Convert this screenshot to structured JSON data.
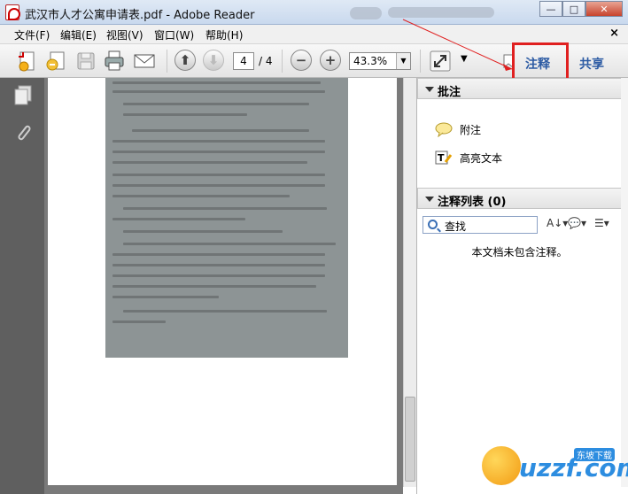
{
  "window": {
    "title": "武汉市人才公寓申请表.pdf - Adobe Reader",
    "controls": {
      "minimize": "—",
      "maximize": "□",
      "close": "✕"
    }
  },
  "menubar": {
    "items": [
      "文件(F)",
      "编辑(E)",
      "视图(V)",
      "窗口(W)",
      "帮助(H)"
    ],
    "close_doc": "×"
  },
  "toolbar": {
    "page_current": "4",
    "page_total": "/ 4",
    "zoom": "43.3%",
    "comment_label": "注释",
    "share_label": "共享"
  },
  "right_pane": {
    "annotations_header": "批注",
    "tools": [
      {
        "icon": "sticky-note-icon",
        "label": "附注"
      },
      {
        "icon": "highlight-text-icon",
        "label": "高亮文本"
      }
    ],
    "comment_list_header": "注释列表 (0)",
    "search_placeholder": "查找",
    "empty_message": "本文档未包含注释。"
  },
  "watermark": {
    "text": "uzzf.com",
    "tag": "东坡下载"
  },
  "colors": {
    "accent": "#2b5aa3",
    "highlight_border": "#e02020",
    "nav_panel": "#5f5f5f"
  }
}
